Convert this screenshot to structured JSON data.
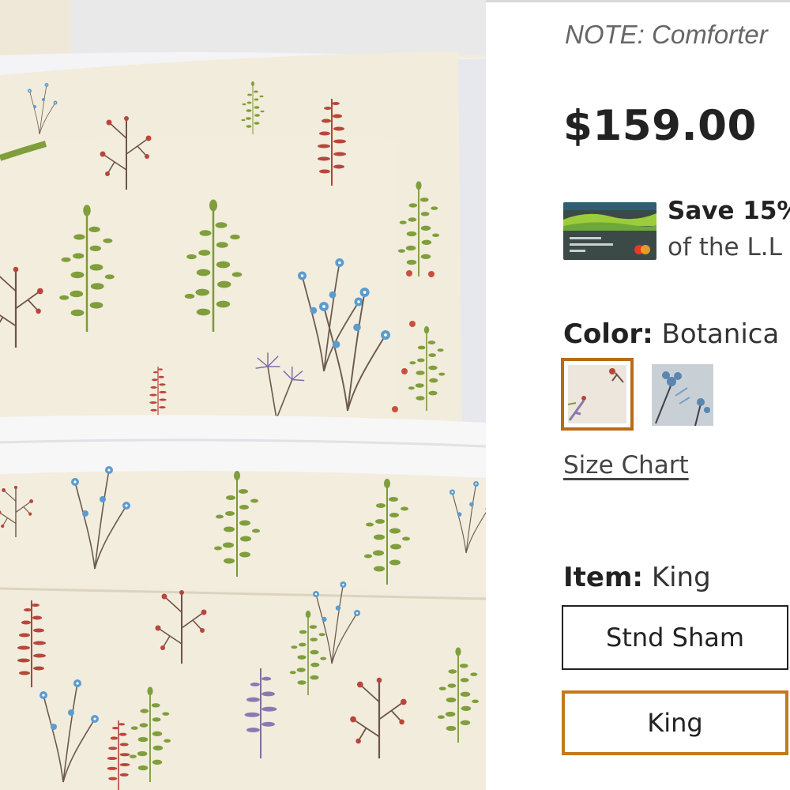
{
  "note_text": "NOTE: Comforter",
  "price": "$159.00",
  "promo": {
    "line1": "Save 15%",
    "line2": "of the L.L",
    "card_icon": "credit-card-icon"
  },
  "color": {
    "label": "Color:",
    "value": "Botanica",
    "swatches": [
      {
        "name": "botanical-cream-swatch",
        "selected": true
      },
      {
        "name": "botanical-blue-swatch",
        "selected": false
      }
    ]
  },
  "size_chart_label": "Size Chart",
  "item": {
    "label": "Item:",
    "value": "King",
    "options": [
      {
        "label": "Stnd Sham",
        "selected": false
      },
      {
        "label": "King",
        "selected": true
      }
    ]
  },
  "colors": {
    "selected_border": "#c27a1d",
    "text_dark": "#222222",
    "fabric_cream": "#f1ecdf"
  }
}
